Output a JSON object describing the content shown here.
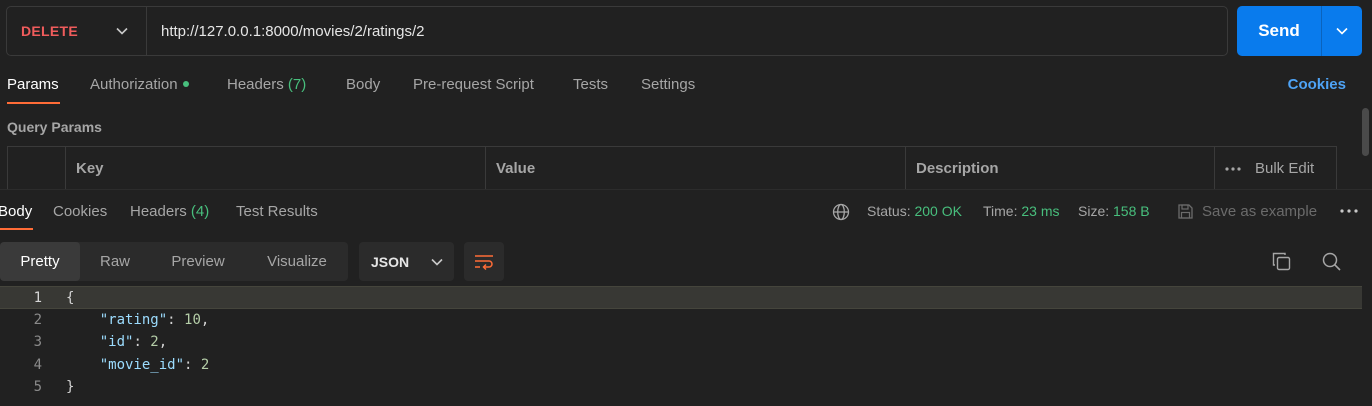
{
  "request": {
    "method": "DELETE",
    "url": "http://127.0.0.1:8000/movies/2/ratings/2",
    "send_label": "Send"
  },
  "request_tabs": {
    "params": "Params",
    "authorization": "Authorization",
    "headers": "Headers",
    "headers_count": "(7)",
    "body": "Body",
    "prerequest": "Pre-request Script",
    "tests": "Tests",
    "settings": "Settings",
    "cookies": "Cookies"
  },
  "query_params": {
    "title": "Query Params",
    "columns": {
      "key": "Key",
      "value": "Value",
      "description": "Description"
    },
    "bulk_edit": "Bulk Edit"
  },
  "response": {
    "tabs": {
      "body": "Body",
      "cookies": "Cookies",
      "headers": "Headers",
      "headers_count": "(4)",
      "test_results": "Test Results"
    },
    "status_label": "Status:",
    "status_value": "200 OK",
    "time_label": "Time:",
    "time_value": "23 ms",
    "size_label": "Size:",
    "size_value": "158 B",
    "save_example": "Save as example",
    "formats": {
      "pretty": "Pretty",
      "raw": "Raw",
      "preview": "Preview",
      "visualize": "Visualize"
    },
    "language": "JSON",
    "body_lines": {
      "n1": "1",
      "n2": "2",
      "n3": "3",
      "n4": "4",
      "n5": "5",
      "open": "{",
      "k1": "\"rating\"",
      "v1": "10",
      "k2": "\"id\"",
      "v2": "2",
      "k3": "\"movie_id\"",
      "v3": "2",
      "close": "}"
    }
  },
  "colors": {
    "method": "#f05c5c",
    "send": "#097bed",
    "accent_underline": "#ff6c37",
    "success": "#48bf7d",
    "link": "#4ea3f5"
  }
}
